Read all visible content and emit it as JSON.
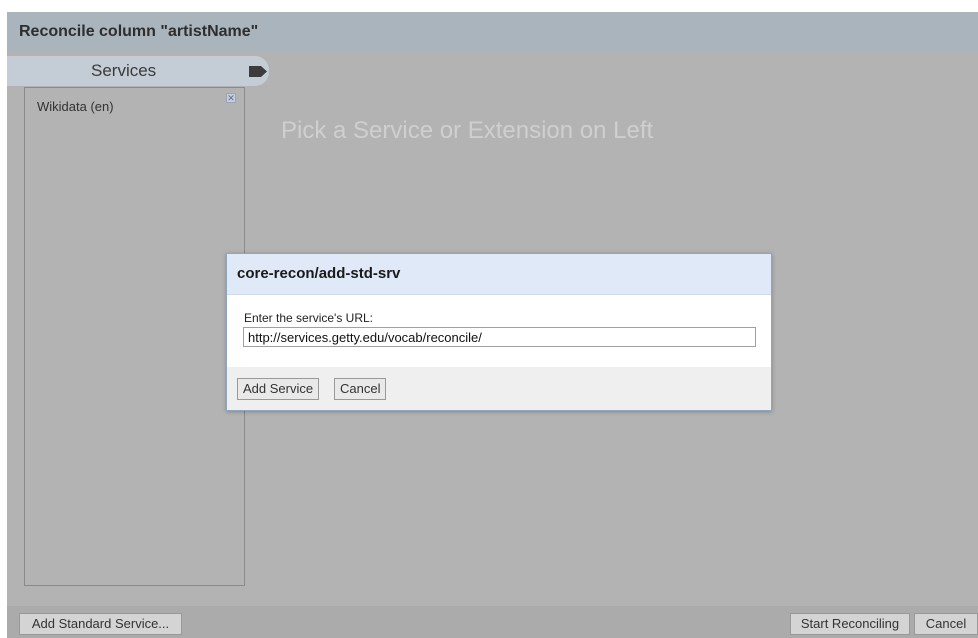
{
  "dialog": {
    "title": "Reconcile column \"artistName\""
  },
  "services": {
    "tab_label": "Services",
    "tag_icon": "tag-icon",
    "items": [
      {
        "label": "Wikidata (en)",
        "remove_icon": "close-icon",
        "remove_glyph": "✕"
      }
    ],
    "placeholder": "Pick a Service or Extension on Left"
  },
  "footer": {
    "add_standard_service": "Add Standard Service...",
    "start_reconciling": "Start Reconciling",
    "cancel": "Cancel"
  },
  "modal": {
    "title": "core-recon/add-std-srv",
    "url_label": "Enter the service's URL:",
    "url_value": "http://services.getty.edu/vocab/reconcile/",
    "add_button": "Add Service",
    "cancel_button": "Cancel"
  },
  "colors": {
    "overlay": "#b3b3b3",
    "header": "#aab4bd",
    "modal_header": "#dfe9f7"
  }
}
